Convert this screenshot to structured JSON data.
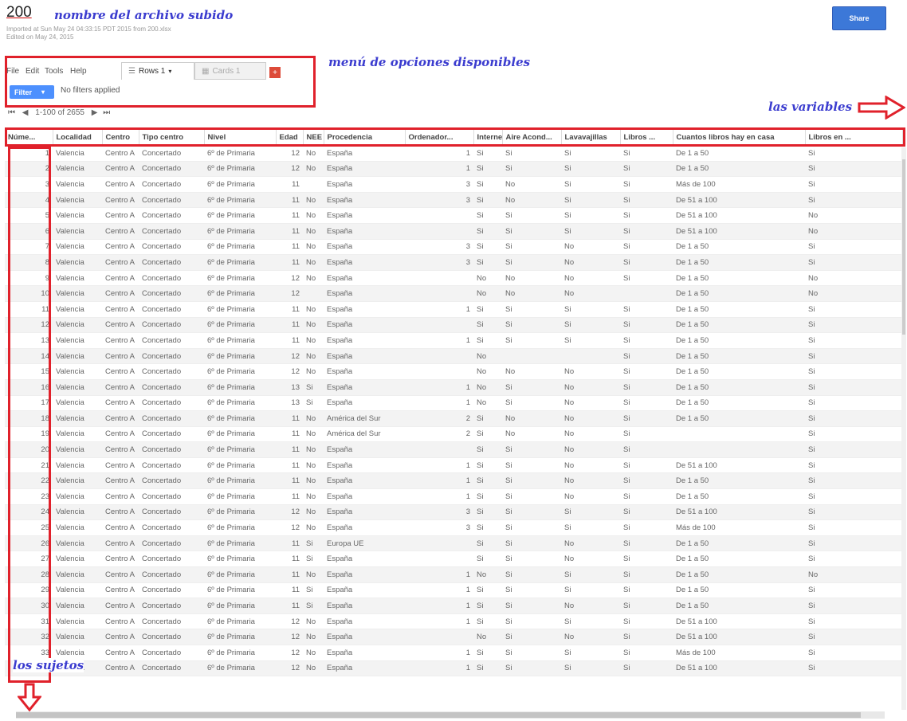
{
  "header": {
    "title": "200",
    "imported": "Imported at Sun May 24 04:33:15 PDT 2015 from 200.xlsx",
    "edited": "Edited on May 24, 2015",
    "share_label": "Share"
  },
  "annotations": {
    "file": "nombre del archivo subido",
    "menu": "menú de opciones disponibles",
    "variables": "las variables",
    "subjects": "los sujetos"
  },
  "menu": {
    "file": "File",
    "edit": "Edit",
    "tools": "Tools",
    "help": "Help"
  },
  "tabs": {
    "rows": "Rows 1",
    "cards": "Cards 1",
    "add": "+"
  },
  "filter": {
    "label": "Filter",
    "status": "No filters applied"
  },
  "pager": {
    "range": "1-100 of 2655"
  },
  "columns": [
    "Núme...",
    "Localidad",
    "Centro",
    "Tipo centro",
    "Nivel",
    "Edad",
    "NEE",
    "Procedencia",
    "Ordenador...",
    "Internet",
    "Aire Acond...",
    "Lavavajillas",
    "Libros ...",
    "Cuantos libros hay en casa",
    "Libros en ..."
  ],
  "rows": [
    [
      "1",
      "Valencia",
      "Centro A",
      "Concertado",
      "6º de Primaria",
      "12",
      "No",
      "España",
      "1",
      "Si",
      "Si",
      "Si",
      "Si",
      "De 1 a 50",
      "Si"
    ],
    [
      "2",
      "Valencia",
      "Centro A",
      "Concertado",
      "6º de Primaria",
      "12",
      "No",
      "España",
      "1",
      "Si",
      "Si",
      "Si",
      "Si",
      "De 1 a 50",
      "Si"
    ],
    [
      "3",
      "Valencia",
      "Centro A",
      "Concertado",
      "6º de Primaria",
      "11",
      "",
      "España",
      "3",
      "Si",
      "No",
      "Si",
      "Si",
      "Más de 100",
      "Si"
    ],
    [
      "4",
      "Valencia",
      "Centro A",
      "Concertado",
      "6º de Primaria",
      "11",
      "No",
      "España",
      "3",
      "Si",
      "No",
      "Si",
      "Si",
      "De 51 a 100",
      "Si"
    ],
    [
      "5",
      "Valencia",
      "Centro A",
      "Concertado",
      "6º de Primaria",
      "11",
      "No",
      "España",
      "",
      "Si",
      "Si",
      "Si",
      "Si",
      "De 51 a 100",
      "No"
    ],
    [
      "6",
      "Valencia",
      "Centro A",
      "Concertado",
      "6º de Primaria",
      "11",
      "No",
      "España",
      "",
      "Si",
      "Si",
      "Si",
      "Si",
      "De 51 a 100",
      "No"
    ],
    [
      "7",
      "Valencia",
      "Centro A",
      "Concertado",
      "6º de Primaria",
      "11",
      "No",
      "España",
      "3",
      "Si",
      "Si",
      "No",
      "Si",
      "De 1 a 50",
      "Si"
    ],
    [
      "8",
      "Valencia",
      "Centro A",
      "Concertado",
      "6º de Primaria",
      "11",
      "No",
      "España",
      "3",
      "Si",
      "Si",
      "No",
      "Si",
      "De 1 a 50",
      "Si"
    ],
    [
      "9",
      "Valencia",
      "Centro A",
      "Concertado",
      "6º de Primaria",
      "12",
      "No",
      "España",
      "",
      "No",
      "No",
      "No",
      "Si",
      "De 1 a 50",
      "No"
    ],
    [
      "10",
      "Valencia",
      "Centro A",
      "Concertado",
      "6º de Primaria",
      "12",
      "",
      "España",
      "",
      "No",
      "No",
      "No",
      "",
      "De 1 a 50",
      "No"
    ],
    [
      "11",
      "Valencia",
      "Centro A",
      "Concertado",
      "6º de Primaria",
      "11",
      "No",
      "España",
      "1",
      "Si",
      "Si",
      "Si",
      "Si",
      "De 1 a 50",
      "Si"
    ],
    [
      "12",
      "Valencia",
      "Centro A",
      "Concertado",
      "6º de Primaria",
      "11",
      "No",
      "España",
      "",
      "Si",
      "Si",
      "Si",
      "Si",
      "De 1 a 50",
      "Si"
    ],
    [
      "13",
      "Valencia",
      "Centro A",
      "Concertado",
      "6º de Primaria",
      "11",
      "No",
      "España",
      "1",
      "Si",
      "Si",
      "Si",
      "Si",
      "De 1 a 50",
      "Si"
    ],
    [
      "14",
      "Valencia",
      "Centro A",
      "Concertado",
      "6º de Primaria",
      "12",
      "No",
      "España",
      "",
      "No",
      "",
      "",
      "Si",
      "De 1 a 50",
      "Si"
    ],
    [
      "15",
      "Valencia",
      "Centro A",
      "Concertado",
      "6º de Primaria",
      "12",
      "No",
      "España",
      "",
      "No",
      "No",
      "No",
      "Si",
      "De 1 a 50",
      "Si"
    ],
    [
      "16",
      "Valencia",
      "Centro A",
      "Concertado",
      "6º de Primaria",
      "13",
      "Si",
      "España",
      "1",
      "No",
      "Si",
      "No",
      "Si",
      "De 1 a 50",
      "Si"
    ],
    [
      "17",
      "Valencia",
      "Centro A",
      "Concertado",
      "6º de Primaria",
      "13",
      "Si",
      "España",
      "1",
      "No",
      "Si",
      "No",
      "Si",
      "De 1 a 50",
      "Si"
    ],
    [
      "18",
      "Valencia",
      "Centro A",
      "Concertado",
      "6º de Primaria",
      "11",
      "No",
      "América del Sur",
      "2",
      "Si",
      "No",
      "No",
      "Si",
      "De 1 a 50",
      "Si"
    ],
    [
      "19",
      "Valencia",
      "Centro A",
      "Concertado",
      "6º de Primaria",
      "11",
      "No",
      "América del Sur",
      "2",
      "Si",
      "No",
      "No",
      "Si",
      "",
      "Si"
    ],
    [
      "20",
      "Valencia",
      "Centro A",
      "Concertado",
      "6º de Primaria",
      "11",
      "No",
      "España",
      "",
      "Si",
      "Si",
      "No",
      "Si",
      "",
      "Si"
    ],
    [
      "21",
      "Valencia",
      "Centro A",
      "Concertado",
      "6º de Primaria",
      "11",
      "No",
      "España",
      "1",
      "Si",
      "Si",
      "No",
      "Si",
      "De 51 a 100",
      "Si"
    ],
    [
      "22",
      "Valencia",
      "Centro A",
      "Concertado",
      "6º de Primaria",
      "11",
      "No",
      "España",
      "1",
      "Si",
      "Si",
      "No",
      "Si",
      "De 1 a 50",
      "Si"
    ],
    [
      "23",
      "Valencia",
      "Centro A",
      "Concertado",
      "6º de Primaria",
      "11",
      "No",
      "España",
      "1",
      "Si",
      "Si",
      "No",
      "Si",
      "De 1 a 50",
      "Si"
    ],
    [
      "24",
      "Valencia",
      "Centro A",
      "Concertado",
      "6º de Primaria",
      "12",
      "No",
      "España",
      "3",
      "Si",
      "Si",
      "Si",
      "Si",
      "De 51 a 100",
      "Si"
    ],
    [
      "25",
      "Valencia",
      "Centro A",
      "Concertado",
      "6º de Primaria",
      "12",
      "No",
      "España",
      "3",
      "Si",
      "Si",
      "Si",
      "Si",
      "Más de 100",
      "Si"
    ],
    [
      "26",
      "Valencia",
      "Centro A",
      "Concertado",
      "6º de Primaria",
      "11",
      "Si",
      "Europa UE",
      "",
      "Si",
      "Si",
      "No",
      "Si",
      "De 1 a 50",
      "Si"
    ],
    [
      "27",
      "Valencia",
      "Centro A",
      "Concertado",
      "6º de Primaria",
      "11",
      "Si",
      "España",
      "",
      "Si",
      "Si",
      "No",
      "Si",
      "De 1 a 50",
      "Si"
    ],
    [
      "28",
      "Valencia",
      "Centro A",
      "Concertado",
      "6º de Primaria",
      "11",
      "No",
      "España",
      "1",
      "No",
      "Si",
      "Si",
      "Si",
      "De 1 a 50",
      "No"
    ],
    [
      "29",
      "Valencia",
      "Centro A",
      "Concertado",
      "6º de Primaria",
      "11",
      "Si",
      "España",
      "1",
      "Si",
      "Si",
      "Si",
      "Si",
      "De 1 a 50",
      "Si"
    ],
    [
      "30",
      "Valencia",
      "Centro A",
      "Concertado",
      "6º de Primaria",
      "11",
      "Si",
      "España",
      "1",
      "Si",
      "Si",
      "No",
      "Si",
      "De 1 a 50",
      "Si"
    ],
    [
      "31",
      "Valencia",
      "Centro A",
      "Concertado",
      "6º de Primaria",
      "12",
      "No",
      "España",
      "1",
      "Si",
      "Si",
      "Si",
      "Si",
      "De 51 a 100",
      "Si"
    ],
    [
      "32",
      "Valencia",
      "Centro A",
      "Concertado",
      "6º de Primaria",
      "12",
      "No",
      "España",
      "",
      "No",
      "Si",
      "No",
      "Si",
      "De 51 a 100",
      "Si"
    ],
    [
      "33",
      "Valencia",
      "Centro A",
      "Concertado",
      "6º de Primaria",
      "12",
      "No",
      "España",
      "1",
      "Si",
      "Si",
      "Si",
      "Si",
      "Más de 100",
      "Si"
    ],
    [
      "34",
      "Valencia",
      "Centro A",
      "Concertado",
      "6º de Primaria",
      "12",
      "No",
      "España",
      "1",
      "Si",
      "Si",
      "Si",
      "Si",
      "De 51 a 100",
      "Si"
    ]
  ]
}
